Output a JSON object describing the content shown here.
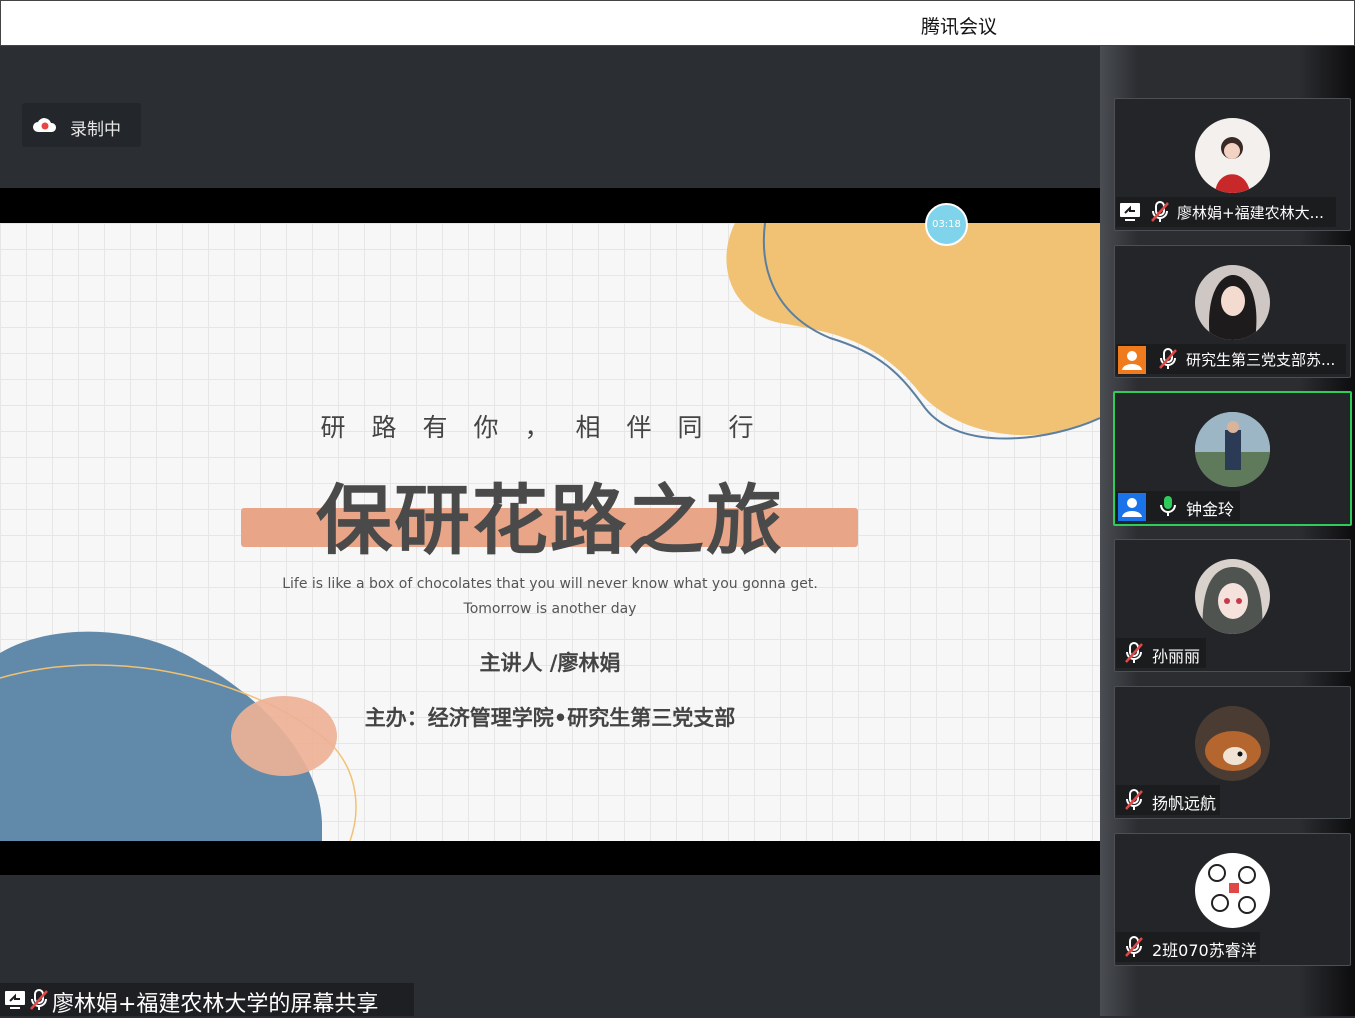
{
  "window": {
    "title": "腾讯会议"
  },
  "recording": {
    "label": "录制中",
    "icon": "cloud-record-icon"
  },
  "slide": {
    "subtitle": "研路有你，相伴同行",
    "title": "保研花路之旅",
    "quote_line1": "Life is like a box of chocolates that you will never know what you gonna get.",
    "quote_line2": "Tomorrow is another day",
    "speaker": "主讲人 /廖林娟",
    "host": "主办：经济管理学院•研究生第三党支部",
    "timer": "03:18"
  },
  "share": {
    "label": "廖林娟+福建农林大学的屏幕共享"
  },
  "participants": [
    {
      "name": "廖林娟+福建农林大...",
      "role_icon": "screen-share-icon",
      "mic": "muted"
    },
    {
      "name": "研究生第三党支部苏...",
      "role_icon": "host-icon",
      "mic": "muted"
    },
    {
      "name": "钟金玲",
      "role_icon": "self-icon",
      "mic": "active"
    },
    {
      "name": "孙丽丽",
      "role_icon": "",
      "mic": "muted"
    },
    {
      "name": "扬帆远航",
      "role_icon": "",
      "mic": "muted"
    },
    {
      "name": "2班070苏睿洋",
      "role_icon": "",
      "mic": "muted"
    }
  ],
  "colors": {
    "accent_active": "#2ecc5a",
    "host_badge": "#f07b1e",
    "self_badge": "#1a73e8",
    "muted": "#e04848",
    "timer": "#7fd3ea"
  }
}
